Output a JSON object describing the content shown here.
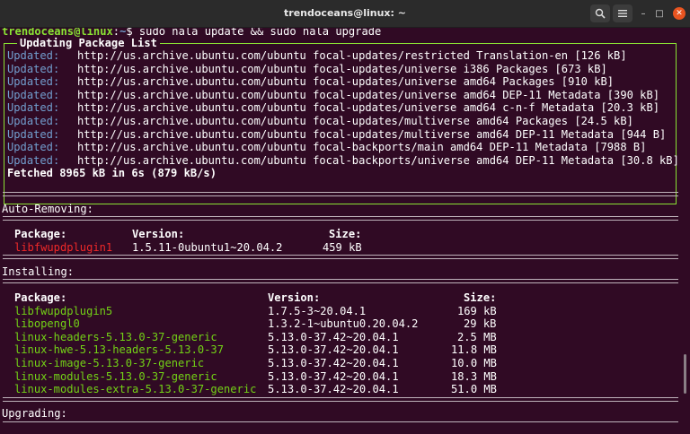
{
  "window": {
    "title": "trendoceans@linux: ~",
    "search_icon": "search-icon",
    "menu_icon": "hamburger-menu-icon",
    "minimize_glyph": "–",
    "maximize_glyph": "□",
    "close_glyph": "✕"
  },
  "prompt": {
    "user_host": "trendoceans@linux",
    "separator": ":",
    "path": "~",
    "symbol": "$",
    "command": " sudo nala update && sudo nala upgrade"
  },
  "update_panel": {
    "title": "Updating Package List",
    "entries": [
      {
        "status": "Updated:",
        "text": "http://us.archive.ubuntu.com/ubuntu focal-updates/restricted Translation-en [126 kB]"
      },
      {
        "status": "Updated:",
        "text": "http://us.archive.ubuntu.com/ubuntu focal-updates/universe i386 Packages [673 kB]"
      },
      {
        "status": "Updated:",
        "text": "http://us.archive.ubuntu.com/ubuntu focal-updates/universe amd64 Packages [910 kB]"
      },
      {
        "status": "Updated:",
        "text": "http://us.archive.ubuntu.com/ubuntu focal-updates/universe amd64 DEP-11 Metadata [390 kB]"
      },
      {
        "status": "Updated:",
        "text": "http://us.archive.ubuntu.com/ubuntu focal-updates/universe amd64 c-n-f Metadata [20.3 kB]"
      },
      {
        "status": "Updated:",
        "text": "http://us.archive.ubuntu.com/ubuntu focal-updates/multiverse amd64 Packages [24.5 kB]"
      },
      {
        "status": "Updated:",
        "text": "http://us.archive.ubuntu.com/ubuntu focal-updates/multiverse amd64 DEP-11 Metadata [944 B]"
      },
      {
        "status": "Updated:",
        "text": "http://us.archive.ubuntu.com/ubuntu focal-backports/main amd64 DEP-11 Metadata [7988 B]"
      },
      {
        "status": "Updated:",
        "text": "http://us.archive.ubuntu.com/ubuntu focal-backports/universe amd64 DEP-11 Metadata [30.8 kB]"
      }
    ],
    "fetched": "Fetched 8965 kB in 6s (879 kB/s)"
  },
  "auto_removing": {
    "heading": "Auto-Removing:",
    "headers": {
      "package": "Package:",
      "version": "Version:",
      "size": "Size:"
    },
    "rows": [
      {
        "package": "libfwupdplugin1",
        "version": "1.5.11-0ubuntu1~20.04.2",
        "size": "459 kB"
      }
    ]
  },
  "installing": {
    "heading": "Installing:",
    "headers": {
      "package": "Package:",
      "version": "Version:",
      "size": "Size:"
    },
    "rows": [
      {
        "package": "libfwupdplugin5",
        "version": "1.7.5-3~20.04.1",
        "size": "169 kB"
      },
      {
        "package": "libopengl0",
        "version": "1.3.2-1~ubuntu0.20.04.2",
        "size": "29 kB"
      },
      {
        "package": "linux-headers-5.13.0-37-generic",
        "version": "5.13.0-37.42~20.04.1",
        "size": "2.5 MB"
      },
      {
        "package": "linux-hwe-5.13-headers-5.13.0-37",
        "version": "5.13.0-37.42~20.04.1",
        "size": "11.8 MB"
      },
      {
        "package": "linux-image-5.13.0-37-generic",
        "version": "5.13.0-37.42~20.04.1",
        "size": "10.0 MB"
      },
      {
        "package": "linux-modules-5.13.0-37-generic",
        "version": "5.13.0-37.42~20.04.1",
        "size": "18.3 MB"
      },
      {
        "package": "linux-modules-extra-5.13.0-37-generic",
        "version": "5.13.0-37.42~20.04.1",
        "size": "51.0 MB"
      }
    ]
  },
  "upgrading": {
    "heading": "Upgrading:"
  },
  "colors": {
    "terminal_bg": "#300a24",
    "titlebar_bg": "#2b2b2b",
    "prompt_user": "#8ae234",
    "prompt_path": "#729fcf",
    "status_updated": "#729fcf",
    "install_package": "#73d216",
    "remove_package": "#ef2929",
    "close_button": "#e95420"
  }
}
